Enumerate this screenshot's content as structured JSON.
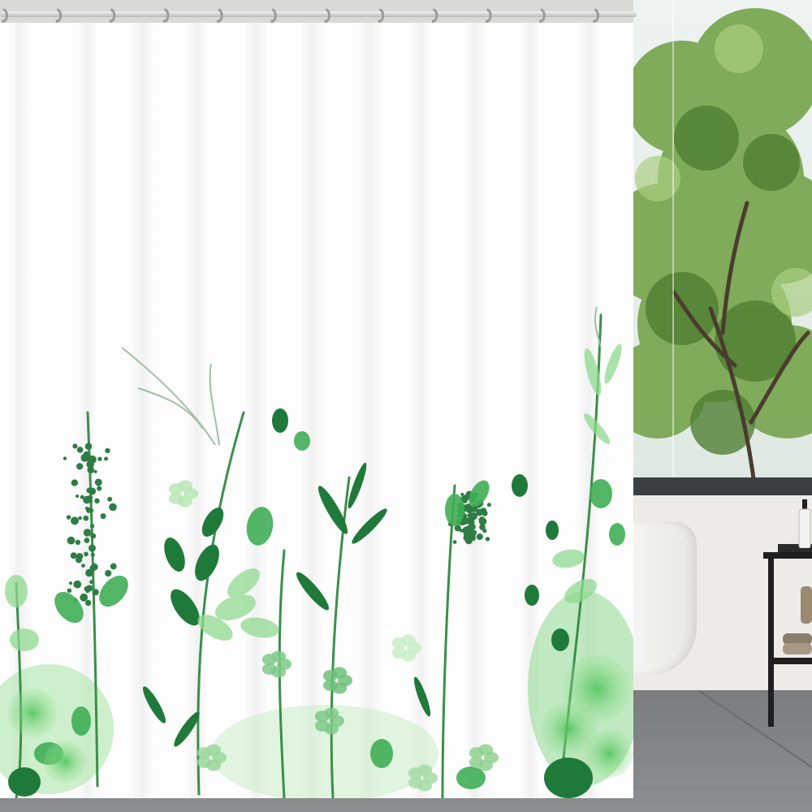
{
  "scene": {
    "description": "",
    "colors": {
      "curtain": "#fdfdfd",
      "leaf_dark": "#1f7a3a",
      "leaf_mid": "#3fae55",
      "leaf_light": "#8fd88f",
      "leaf_pale": "#c9edc6",
      "tree": "#6fa049"
    },
    "ring_count": 12
  }
}
